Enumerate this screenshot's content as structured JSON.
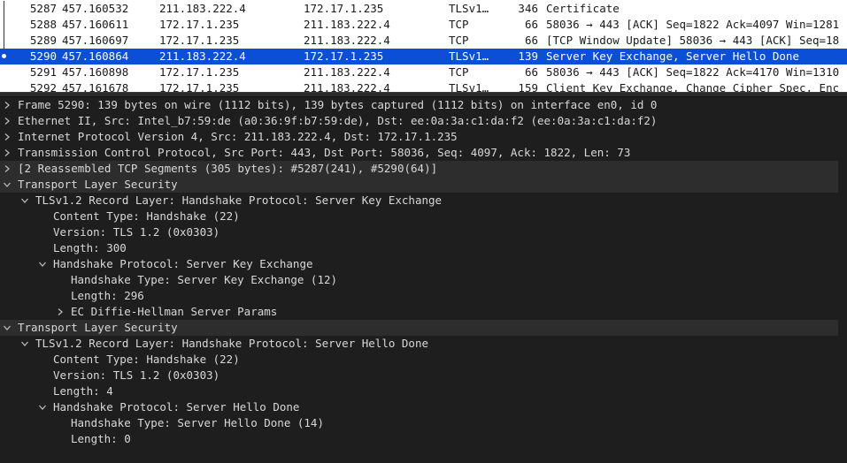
{
  "packets": [
    {
      "no": "5287",
      "time": "457.160532",
      "src": "211.183.222.4",
      "dst": "172.17.1.235",
      "proto": "TLSv1…",
      "len": "346",
      "info": "Certificate"
    },
    {
      "no": "5288",
      "time": "457.160611",
      "src": "172.17.1.235",
      "dst": "211.183.222.4",
      "proto": "TCP",
      "len": "66",
      "info": "58036 → 443 [ACK] Seq=1822 Ack=4097 Win=1281"
    },
    {
      "no": "5289",
      "time": "457.160697",
      "src": "172.17.1.235",
      "dst": "211.183.222.4",
      "proto": "TCP",
      "len": "66",
      "info": "[TCP Window Update] 58036 → 443 [ACK] Seq=18"
    },
    {
      "no": "5290",
      "time": "457.160864",
      "src": "211.183.222.4",
      "dst": "172.17.1.235",
      "proto": "TLSv1…",
      "len": "139",
      "info": "Server Key Exchange, Server Hello Done"
    },
    {
      "no": "5291",
      "time": "457.160898",
      "src": "172.17.1.235",
      "dst": "211.183.222.4",
      "proto": "TCP",
      "len": "66",
      "info": "58036 → 443 [ACK] Seq=1822 Ack=4170 Win=1310"
    },
    {
      "no": "5292",
      "time": "457.161678",
      "src": "172.17.1.235",
      "dst": "211.183.222.4",
      "proto": "TLSv1…",
      "len": "159",
      "info": "Client Key Exchange, Change Cipher Spec, Enc"
    }
  ],
  "selected_packet": "5290",
  "tree": [
    {
      "indent": 0,
      "arrow": "collapsed",
      "text": "Frame 5290: 139 bytes on wire (1112 bits), 139 bytes captured (1112 bits) on interface en0, id 0"
    },
    {
      "indent": 0,
      "arrow": "collapsed",
      "text": "Ethernet II, Src: Intel_b7:59:de (a0:36:9f:b7:59:de), Dst: ee:0a:3a:c1:da:f2 (ee:0a:3a:c1:da:f2)"
    },
    {
      "indent": 0,
      "arrow": "collapsed",
      "text": "Internet Protocol Version 4, Src: 211.183.222.4, Dst: 172.17.1.235"
    },
    {
      "indent": 0,
      "arrow": "collapsed",
      "text": "Transmission Control Protocol, Src Port: 443, Dst Port: 58036, Seq: 4097, Ack: 1822, Len: 73"
    },
    {
      "indent": 0,
      "arrow": "collapsed",
      "text": "[2 Reassembled TCP Segments (305 bytes): #5287(241), #5290(64)]"
    },
    {
      "indent": 0,
      "arrow": "expanded",
      "text": "Transport Layer Security"
    },
    {
      "indent": 1,
      "arrow": "expanded",
      "text": "TLSv1.2 Record Layer: Handshake Protocol: Server Key Exchange"
    },
    {
      "indent": 2,
      "arrow": "none",
      "text": "Content Type: Handshake (22)"
    },
    {
      "indent": 2,
      "arrow": "none",
      "text": "Version: TLS 1.2 (0x0303)"
    },
    {
      "indent": 2,
      "arrow": "none",
      "text": "Length: 300"
    },
    {
      "indent": 2,
      "arrow": "expanded",
      "text": "Handshake Protocol: Server Key Exchange"
    },
    {
      "indent": 3,
      "arrow": "none",
      "text": "Handshake Type: Server Key Exchange (12)"
    },
    {
      "indent": 3,
      "arrow": "none",
      "text": "Length: 296"
    },
    {
      "indent": 3,
      "arrow": "collapsed",
      "text": "EC Diffie-Hellman Server Params"
    },
    {
      "indent": 0,
      "arrow": "expanded",
      "text": "Transport Layer Security"
    },
    {
      "indent": 1,
      "arrow": "expanded",
      "text": "TLSv1.2 Record Layer: Handshake Protocol: Server Hello Done"
    },
    {
      "indent": 2,
      "arrow": "none",
      "text": "Content Type: Handshake (22)"
    },
    {
      "indent": 2,
      "arrow": "none",
      "text": "Version: TLS 1.2 (0x0303)"
    },
    {
      "indent": 2,
      "arrow": "none",
      "text": "Length: 4"
    },
    {
      "indent": 2,
      "arrow": "expanded",
      "text": "Handshake Protocol: Server Hello Done"
    },
    {
      "indent": 3,
      "arrow": "none",
      "text": "Handshake Type: Server Hello Done (14)"
    },
    {
      "indent": 3,
      "arrow": "none",
      "text": "Length: 0"
    }
  ],
  "colors": {
    "selection": "#0a4fd6",
    "tree_background": "#1e1e1e",
    "band": "#2d2d2d"
  }
}
